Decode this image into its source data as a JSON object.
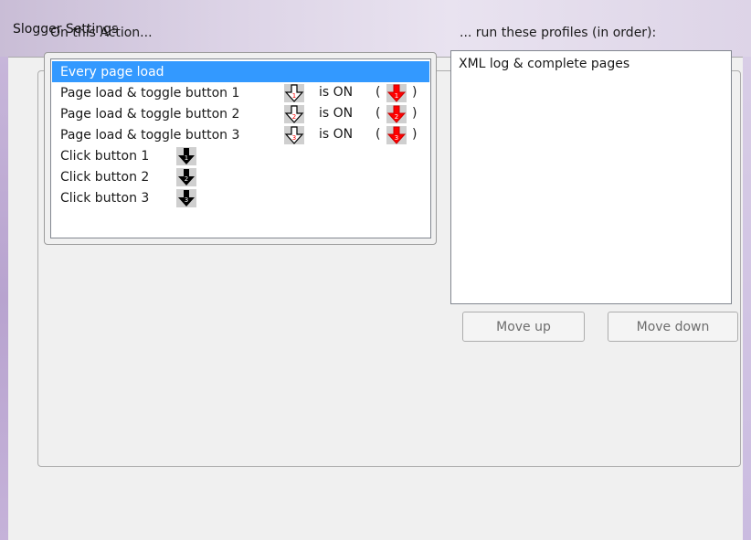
{
  "window": {
    "title": "Slogger Settings"
  },
  "actions": {
    "label": "On this Action...",
    "items": [
      {
        "label": "Every page load"
      },
      {
        "label": "Page load & toggle button 1",
        "state": "is ON",
        "open": "(",
        "close": ")",
        "num": "1"
      },
      {
        "label": "Page load & toggle button 2",
        "state": "is ON",
        "open": "(",
        "close": ")",
        "num": "2"
      },
      {
        "label": "Page load & toggle button 3",
        "state": "is ON",
        "open": "(",
        "close": ")",
        "num": "3"
      },
      {
        "label": "Click button 1",
        "num": "1"
      },
      {
        "label": "Click button 2",
        "num": "2"
      },
      {
        "label": "Click button 3",
        "num": "3"
      }
    ],
    "selected_index": 0
  },
  "profiles": {
    "label": "... run these profiles (in order):",
    "items": [
      "XML log & complete pages"
    ]
  },
  "buttons": {
    "move_up": "Move up",
    "move_down": "Move down"
  },
  "colors": {
    "selection": "#3399ff",
    "active_arrow": "#ff0000",
    "button_arrow": "#000000"
  },
  "icons": {
    "toggle_off": "white-down-arrow-icon",
    "toggle_on": "red-down-arrow-icon",
    "click": "black-down-arrow-icon"
  }
}
